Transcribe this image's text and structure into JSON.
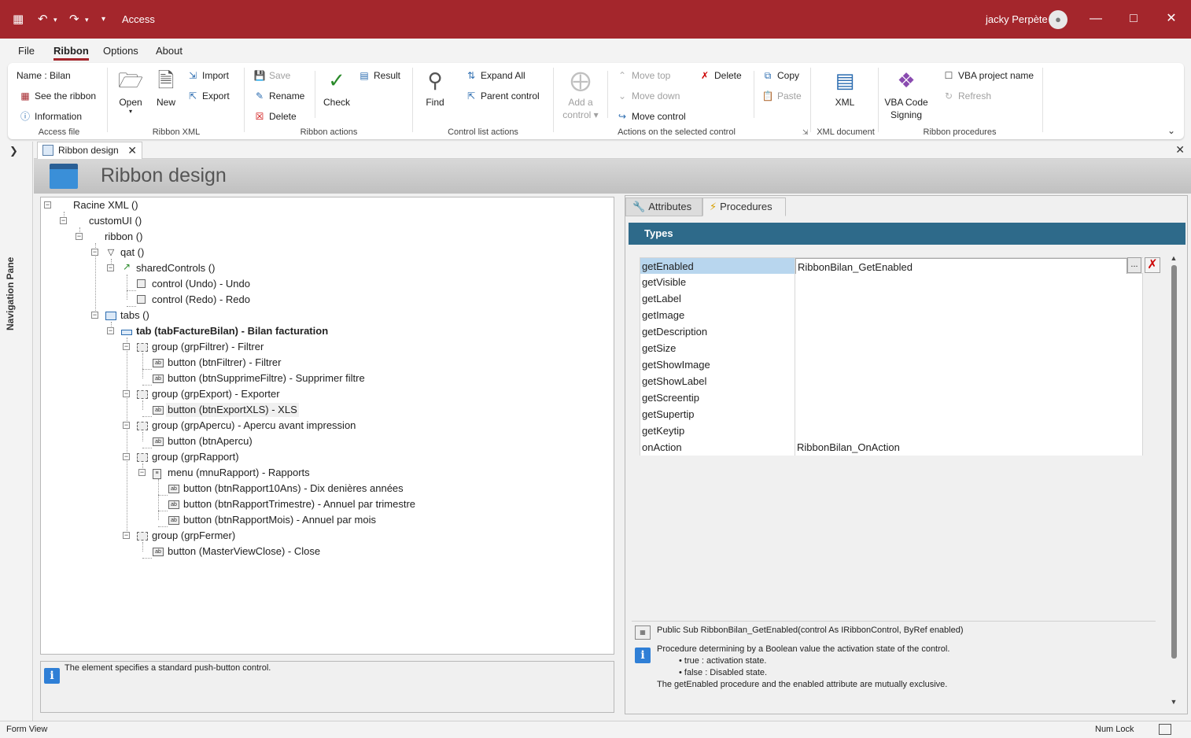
{
  "titlebar": {
    "app_title": "Access",
    "user_name": "jacky Perpète",
    "icons": [
      "access-logo-icon",
      "undo-icon",
      "redo-icon",
      "customize-qat-icon",
      "avatar-icon",
      "minimize-icon",
      "maximize-icon",
      "close-icon"
    ]
  },
  "menu": {
    "tabs": [
      {
        "label": "File"
      },
      {
        "label": "Ribbon"
      },
      {
        "label": "Options"
      },
      {
        "label": "About"
      }
    ]
  },
  "ribbon": {
    "access_file": {
      "name_label": "Name : Bilan",
      "see_ribbon": "See the ribbon",
      "information": "Information",
      "group_label": "Access file"
    },
    "ribbon_xml": {
      "open": "Open",
      "new": "New",
      "import": "Import",
      "export": "Export",
      "group_label": "Ribbon XML"
    },
    "ribbon_actions": {
      "save": "Save",
      "rename": "Rename",
      "delete": "Delete",
      "check": "Check",
      "result": "Result",
      "group_label": "Ribbon actions"
    },
    "control_list": {
      "find": "Find",
      "expand_all": "Expand All",
      "parent_control": "Parent control",
      "group_label": "Control list actions"
    },
    "selected_control": {
      "add_control": "Add a",
      "add_control_2": "control",
      "move_top": "Move top",
      "move_down": "Move down",
      "move_control": "Move control",
      "delete": "Delete",
      "copy": "Copy",
      "paste": "Paste",
      "group_label": "Actions on the selected control"
    },
    "xml_document": {
      "xml": "XML",
      "group_label": "XML document"
    },
    "procedures": {
      "vba_code": "VBA Code",
      "signing": "Signing",
      "vba_project_name": "VBA project name",
      "refresh": "Refresh",
      "group_label": "Ribbon procedures"
    }
  },
  "nav": {
    "label": "Navigation Pane"
  },
  "doc": {
    "tab_label": "Ribbon design",
    "header_title": "Ribbon design"
  },
  "tree": {
    "nodes": [
      {
        "label": "Racine XML ()"
      },
      {
        "label": "customUI ()"
      },
      {
        "label": "ribbon ()"
      },
      {
        "label": "qat ()"
      },
      {
        "label": "sharedControls ()"
      },
      {
        "label": "control (Undo) - Undo"
      },
      {
        "label": "control (Redo) - Redo"
      },
      {
        "label": "tabs ()"
      },
      {
        "label": "tab (tabFactureBilan) - Bilan facturation"
      },
      {
        "label": "group (grpFiltrer) - Filtrer"
      },
      {
        "label": "button (btnFiltrer) - Filtrer"
      },
      {
        "label": "button (btnSupprimeFiltre) - Supprimer filtre"
      },
      {
        "label": "group (grpExport) - Exporter"
      },
      {
        "label": "button (btnExportXLS) - XLS"
      },
      {
        "label": "group (grpApercu) - Apercu avant impression"
      },
      {
        "label": "button (btnApercu)"
      },
      {
        "label": "group (grpRapport)"
      },
      {
        "label": "menu (mnuRapport) - Rapports"
      },
      {
        "label": "button (btnRapport10Ans) - Dix denières années"
      },
      {
        "label": "button (btnRapportTrimestre) - Annuel par trimestre"
      },
      {
        "label": "button (btnRapportMois) - Annuel par mois"
      },
      {
        "label": "group (grpFermer)"
      },
      {
        "label": "button (MasterViewClose) - Close"
      }
    ],
    "info": "The element specifies a standard push-button control.",
    "info_badge": "i"
  },
  "panel": {
    "tab_attributes": "Attributes",
    "tab_procedures": "Procedures",
    "types_title": "Types",
    "rows": [
      {
        "name": "getEnabled",
        "value": "RibbonBilan_GetEnabled"
      },
      {
        "name": "getVisible",
        "value": ""
      },
      {
        "name": "getLabel",
        "value": ""
      },
      {
        "name": "getImage",
        "value": ""
      },
      {
        "name": "getDescription",
        "value": ""
      },
      {
        "name": "getSize",
        "value": ""
      },
      {
        "name": "getShowImage",
        "value": ""
      },
      {
        "name": "getShowLabel",
        "value": ""
      },
      {
        "name": "getScreentip",
        "value": ""
      },
      {
        "name": "getSupertip",
        "value": ""
      },
      {
        "name": "getKeytip",
        "value": ""
      },
      {
        "name": "onAction",
        "value": "RibbonBilan_OnAction"
      }
    ],
    "ellipsis": "...",
    "signature": "Public Sub RibbonBilan_GetEnabled(control As IRibbonControl, ByRef enabled)",
    "desc_line1": "Procedure determining by a Boolean value the activation state of the control.",
    "desc_line2": "• true : activation state.",
    "desc_line3": "• false : Disabled state.",
    "desc_line4": "The getEnabled procedure and the enabled attribute are mutually exclusive.",
    "info_badge": "i"
  },
  "status": {
    "left": "Form View",
    "num_lock": "Num Lock"
  },
  "colors": {
    "title_bar": "#a4262c",
    "types_bar": "#2e6a8a",
    "selected_row": "#b8d6ee",
    "info_badge": "#2f7fd6"
  }
}
